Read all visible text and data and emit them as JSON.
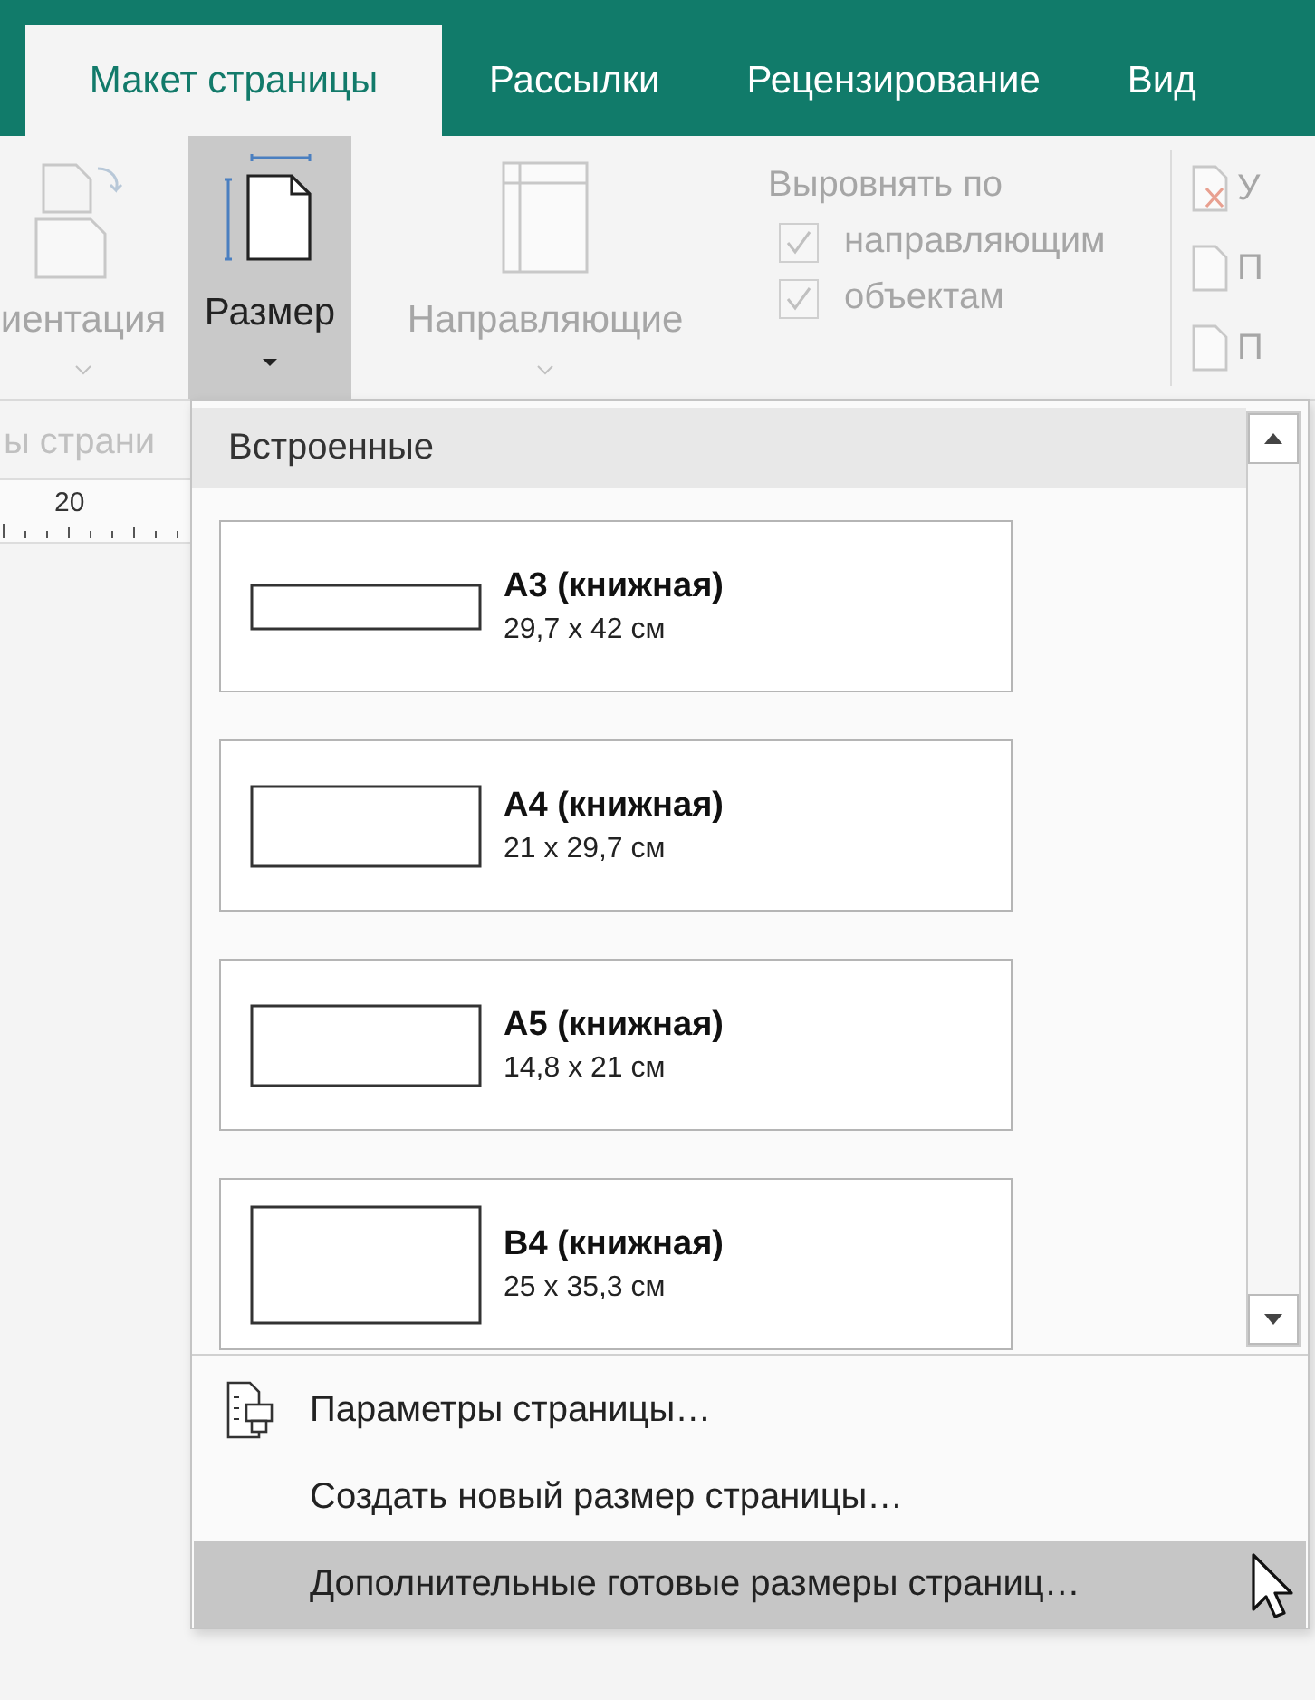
{
  "tabs": [
    {
      "label": "Макет страницы",
      "selected": true
    },
    {
      "label": "Рассылки",
      "selected": false
    },
    {
      "label": "Рецензирование",
      "selected": false
    },
    {
      "label": "Вид",
      "selected": false
    }
  ],
  "ribbon": {
    "orientation_label": "иентация",
    "size_button": {
      "label": "Размер",
      "selected": true
    },
    "guides_label": "Направляющие",
    "align": {
      "title": "Выровнять по",
      "options": [
        {
          "label": "направляющим",
          "checked": true
        },
        {
          "label": "объектам",
          "checked": true
        }
      ]
    },
    "right_letters": [
      "У",
      "П",
      "П"
    ],
    "group_label": "ы страни"
  },
  "ruler": {
    "label": "20"
  },
  "dropdown": {
    "header": "Встроенные",
    "sizes": [
      {
        "name": "А3 (книжная)",
        "dims": "29,7 x 42 см"
      },
      {
        "name": "А4 (книжная)",
        "dims": "21 x 29,7 см"
      },
      {
        "name": "А5 (книжная)",
        "dims": "14,8 x 21 см"
      },
      {
        "name": "В4 (книжная)",
        "dims": "25 x 35,3 см"
      }
    ],
    "commands": [
      {
        "label": "Параметры страницы…",
        "selected": false
      },
      {
        "label": "Создать новый размер страницы…",
        "selected": false
      },
      {
        "label": "Дополнительные готовые размеры страниц…",
        "selected": true
      }
    ]
  }
}
